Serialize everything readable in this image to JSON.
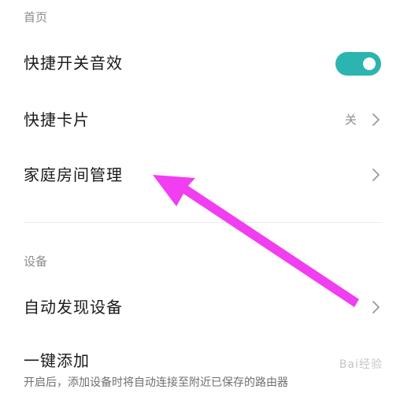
{
  "sections": {
    "home_header": "首页",
    "device_header": "设备"
  },
  "rows": {
    "quick_switch_sound": {
      "label": "快捷开关音效",
      "toggle_state": "on",
      "toggle_color": "#2cb5b0"
    },
    "quick_cards": {
      "label": "快捷卡片",
      "value": "关"
    },
    "home_room_management": {
      "label": "家庭房间管理"
    },
    "auto_discover_devices": {
      "label": "自动发现设备"
    },
    "one_click_add": {
      "label": "一键添加",
      "description": "开启后，添加设备时将自动连接至附近已保存的路由器"
    }
  },
  "annotation": {
    "arrow_color": "#f03ef0",
    "icon": "arrow-annotation"
  },
  "watermark": "Bai经验"
}
